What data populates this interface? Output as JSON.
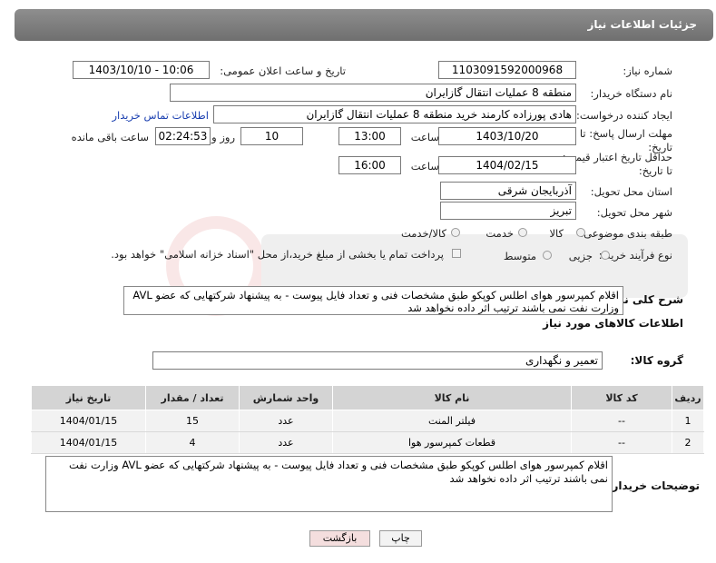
{
  "panel_title": "جزئیات اطلاعات نیاز",
  "fields": {
    "need_number_label": "شماره نیاز:",
    "need_number": "1103091592000968",
    "announce_label": "تاریخ و ساعت اعلان عمومی:",
    "announce_value": "1403/10/10 - 10:06",
    "buyer_label": "نام دستگاه خریدار:",
    "buyer_value": "منطقه 8 عملیات انتقال گازایران",
    "requester_label": "ایجاد کننده درخواست:",
    "requester_value": "هادی پورزاده کارمند خرید منطقه 8 عملیات انتقال گازایران",
    "contact_link": "اطلاعات تماس خریدار",
    "deadline_label": "مهلت ارسال پاسخ: تا تاریخ:",
    "deadline_date": "1403/10/20",
    "time_word": "ساعت",
    "deadline_time": "13:00",
    "days_value": "10",
    "days_word": "روز و",
    "remaining_time": "02:24:53",
    "remaining_word": "ساعت باقی مانده",
    "price_validity_label": "حداقل تاریخ اعتبار قیمت: تا تاریخ:",
    "price_date": "1404/02/15",
    "price_time": "16:00",
    "province_label": "استان محل تحویل:",
    "province_value": "آذربایجان شرقی",
    "city_label": "شهر محل تحویل:",
    "city_value": "تبریز",
    "category_label": "طبقه بندی موضوعی:",
    "cat_goods": "کالا",
    "cat_service": "خدمت",
    "cat_goods_service": "کالا/خدمت",
    "process_label": "نوع فرآیند خرید :",
    "proc_minor": "جزیی",
    "proc_medium": "متوسط",
    "payment_note": "پرداخت تمام یا بخشی از مبلغ خرید،از محل \"اسناد خزانه اسلامی\" خواهد بود."
  },
  "summary": {
    "label": "شرح کلی نیاز:",
    "text": "اقلام کمپرسور هوای اطلس کوپکو طبق مشخصات فنی و تعداد فایل پیوست - به پیشنهاد شرکتهایی که عضو AVL وزارت نفت نمی باشند ترتیب اثر داده نخواهد شد"
  },
  "goods_section": {
    "title": "اطلاعات کالاهای مورد نیاز",
    "group_label": "گروه کالا:",
    "group_value": "تعمیر و نگهداری"
  },
  "table": {
    "headers": [
      "ردیف",
      "کد کالا",
      "نام کالا",
      "واحد شمارش",
      "تعداد / مقدار",
      "تاریخ نیاز"
    ],
    "rows": [
      [
        "1",
        "--",
        "فیلتر المنت",
        "عدد",
        "15",
        "1404/01/15"
      ],
      [
        "2",
        "--",
        "قطعات کمپرسور هوا",
        "عدد",
        "4",
        "1404/01/15"
      ]
    ]
  },
  "buyer_notes": {
    "label": "توضیحات خریدار:",
    "text": "اقلام کمپرسور هوای اطلس کوپکو طبق مشخصات فنی و تعداد فایل پیوست - به پیشنهاد شرکتهایی که عضو AVL وزارت نفت نمی باشند ترتیب اثر داده نخواهد شد"
  },
  "buttons": {
    "print": "چاپ",
    "back": "بازگشت"
  },
  "colors": {
    "header_bg": "#7d7d7d",
    "table_header": "#d4d4d4",
    "link": "#1a3fb0",
    "back_button": "#f4dede"
  }
}
